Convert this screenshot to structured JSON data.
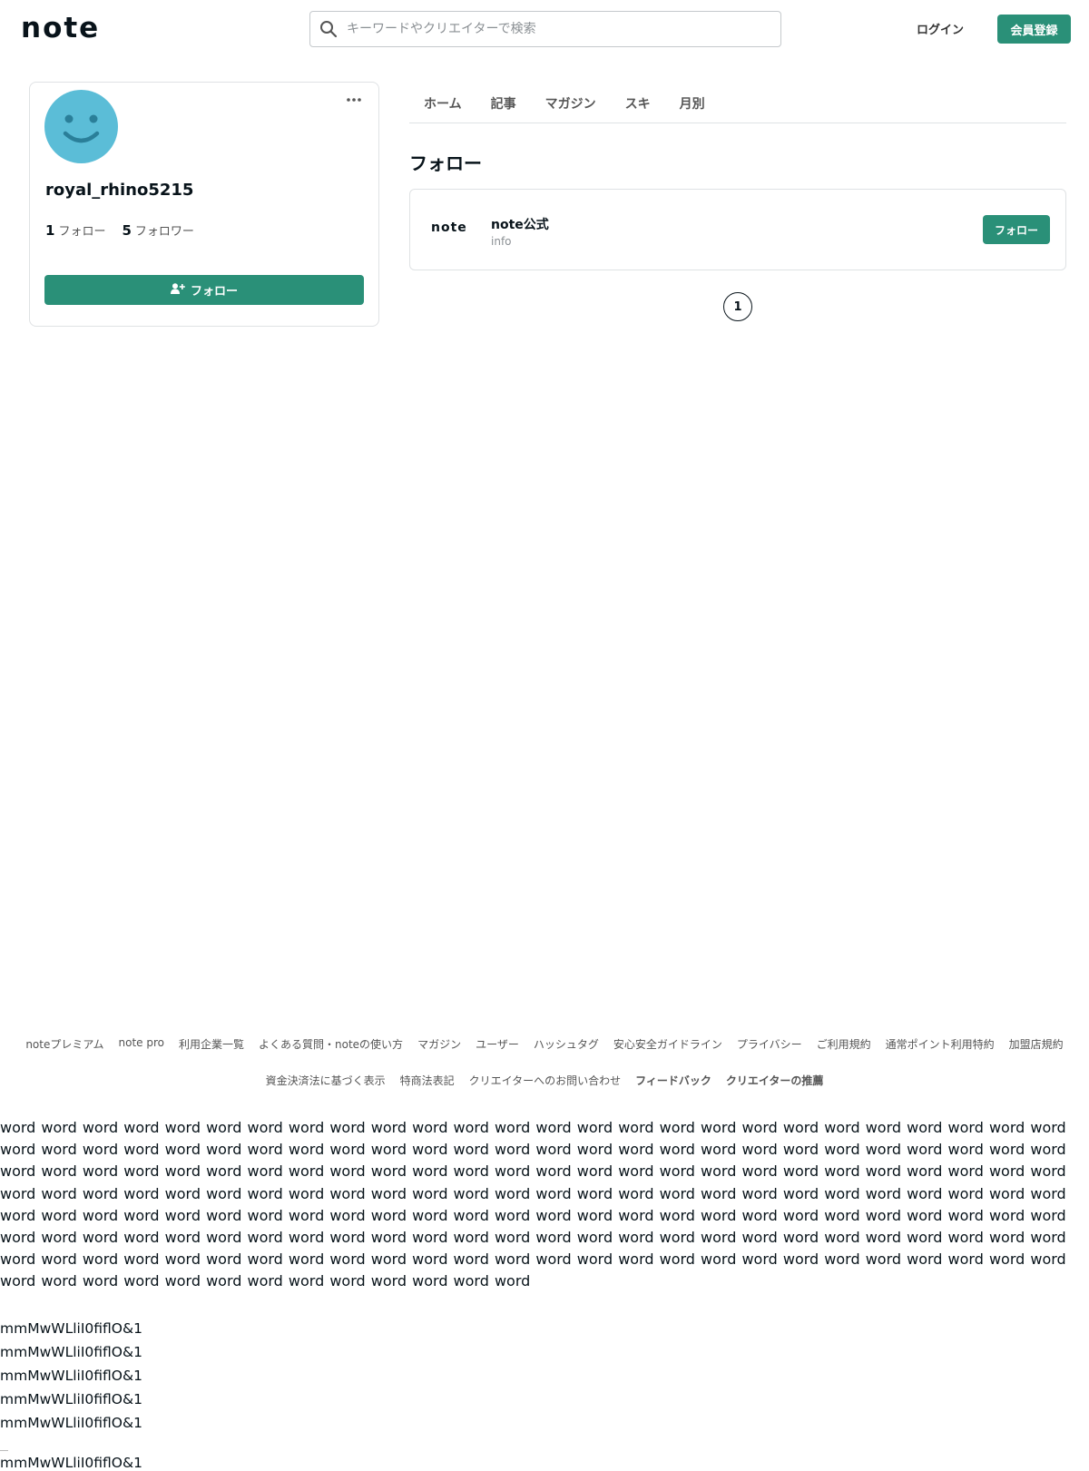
{
  "header": {
    "logo": "note",
    "search_placeholder": "キーワードやクリエイターで検索",
    "login": "ログイン",
    "register": "会員登録"
  },
  "profile": {
    "username": "royal_rhino5215",
    "following_count": "1",
    "following_label": "フォロー",
    "followers_count": "5",
    "followers_label": "フォロワー",
    "follow_button": "フォロー"
  },
  "tabs": [
    "ホーム",
    "記事",
    "マガジン",
    "スキ",
    "月別"
  ],
  "section_title": "フォロー",
  "follow_list": [
    {
      "logo": "note",
      "name": "note公式",
      "sub": "info",
      "button": "フォロー"
    }
  ],
  "pagination": {
    "current": "1"
  },
  "footer": {
    "row1": [
      "noteプレミアム",
      "note pro",
      "利用企業一覧",
      "よくある質問・noteの使い方",
      "マガジン",
      "ユーザー",
      "ハッシュタグ",
      "安心安全ガイドライン",
      "プライバシー",
      "ご利用規約",
      "通常ポイント利用特約",
      "加盟店規約"
    ],
    "row2": [
      "資金決済法に基づく表示",
      "特商法表記",
      "クリエイターへのお問い合わせ"
    ],
    "row2_bold": [
      "フィードバック",
      "クリエイターの推薦"
    ]
  },
  "test_text": {
    "words": "word word word word word word word word word word word word word word word word word word word word word word word word word word word word word word word word word word word word word word word word word word word word word word word word word word word word word word word word word word word word word word word word word word word word word word word word word word word word word word word word word word word word word word word word word word word word word word word word word word word word word word word word word word word word word word word word word word word word word word word word word word word word word word word word word word word word word word word word word word word word word word word word word word word word word word word word word word word word word word word word word word word word word word word word word word word word word word word word word word word word word word word word word word word word word word word word word word word",
    "glyph_line": "mmMwWLliI0fiflO&1",
    "glyph_lines_count_before_rule": 5
  },
  "colors": {
    "accent": "#2a9078",
    "avatar": "#5bbdd7"
  }
}
